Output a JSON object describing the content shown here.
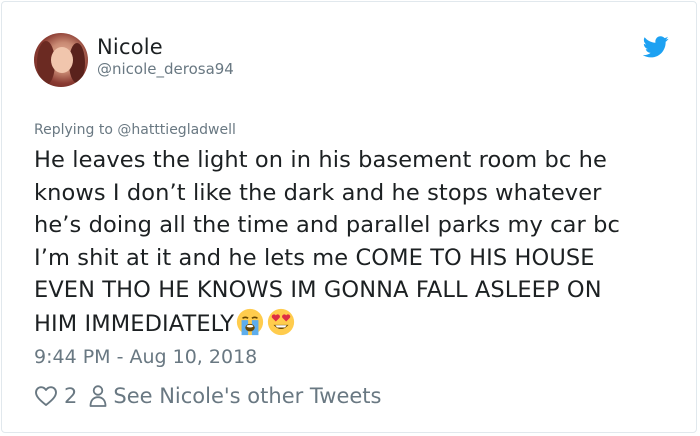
{
  "tweet": {
    "author": {
      "display_name": "Nicole",
      "handle": "@nicole_derosa94"
    },
    "reply_to": "Replying to @hatttiegladwell",
    "lines": [
      "He leaves the light on in his basement room bc he",
      "knows I don’t like the dark and he stops whatever",
      "he’s doing all the time and parallel parks my car bc",
      "I’m shit at it and he lets me COME TO HIS HOUSE",
      "EVEN THO HE KNOWS IM GONNA FALL ASLEEP ON",
      "HIM IMMEDIATELY"
    ],
    "emojis": [
      "loudly-crying-face-icon",
      "heart-eyes-face-icon"
    ],
    "timestamp": "9:44 PM - Aug 10, 2018",
    "likes": "2",
    "see_more": "See Nicole's other Tweets"
  },
  "colors": {
    "text": "#1c2022",
    "secondary": "#697882",
    "twitter_blue": "#1da1f2",
    "border": "#e1e8ed"
  }
}
